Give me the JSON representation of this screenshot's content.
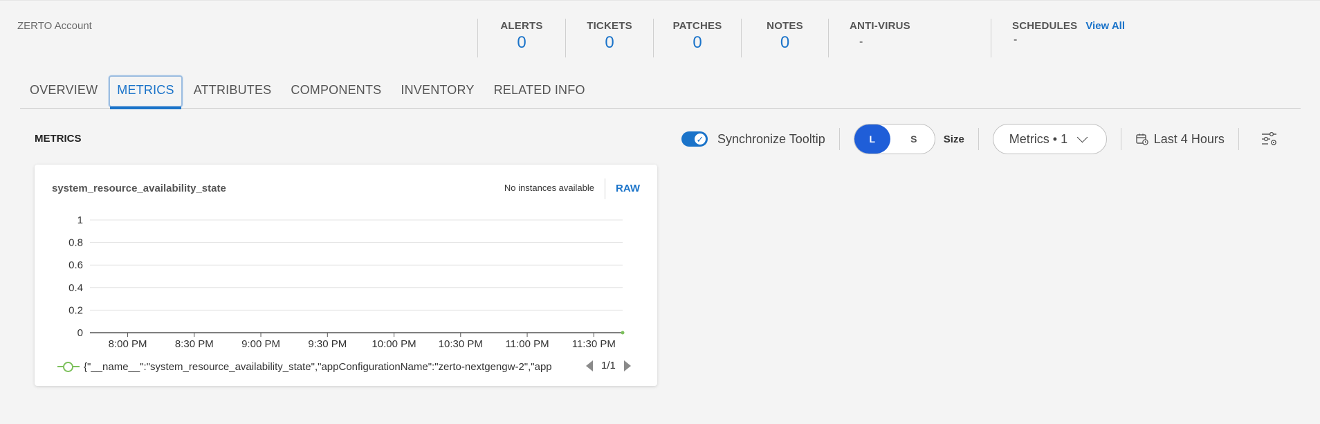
{
  "header": {
    "account": "ZERTO Account",
    "stats": [
      {
        "label": "ALERTS",
        "value": "0"
      },
      {
        "label": "TICKETS",
        "value": "0"
      },
      {
        "label": "PATCHES",
        "value": "0"
      },
      {
        "label": "NOTES",
        "value": "0"
      }
    ],
    "antivirus": {
      "label": "ANTI-VIRUS",
      "value": "-"
    },
    "schedules": {
      "label": "SCHEDULES",
      "link": "View All",
      "value": "-"
    }
  },
  "tabs": [
    "OVERVIEW",
    "METRICS",
    "ATTRIBUTES",
    "COMPONENTS",
    "INVENTORY",
    "RELATED INFO"
  ],
  "active_tab": "METRICS",
  "metrics": {
    "section_title": "METRICS",
    "sync_label": "Synchronize Tooltip",
    "sync_on": true,
    "size_options": [
      "L",
      "S"
    ],
    "size_label": "Size",
    "metrics_dropdown": "Metrics • 1",
    "time_range": "Last 4 Hours",
    "accent_color": "#1a73c9",
    "icons": [
      "check-icon",
      "chevron-down-icon",
      "calendar-icon",
      "filter-settings-icon"
    ]
  },
  "card": {
    "title": "system_resource_availability_state",
    "no_instances": "No instances available",
    "raw_label": "RAW",
    "legend": "{\"__name__\":\"system_resource_availability_state\",\"appConfigurationName\":\"zerto-nextgengw-2\",\"app",
    "pager": "1/1"
  },
  "chart_data": {
    "type": "line",
    "ylim": [
      0,
      1
    ],
    "y_ticks": [
      "1",
      "0.8",
      "0.6",
      "0.4",
      "0.2",
      "0"
    ],
    "x_ticks": [
      "8:00 PM",
      "8:30 PM",
      "9:00 PM",
      "9:30 PM",
      "10:00 PM",
      "10:30 PM",
      "11:00 PM",
      "11:30 PM"
    ],
    "x_range": [
      "7:43 PM",
      "11:43 PM"
    ],
    "series": [
      {
        "color": "#7cc05b",
        "points": [
          {
            "x": "11:43 PM",
            "y": 0
          }
        ]
      }
    ],
    "grid": true
  }
}
